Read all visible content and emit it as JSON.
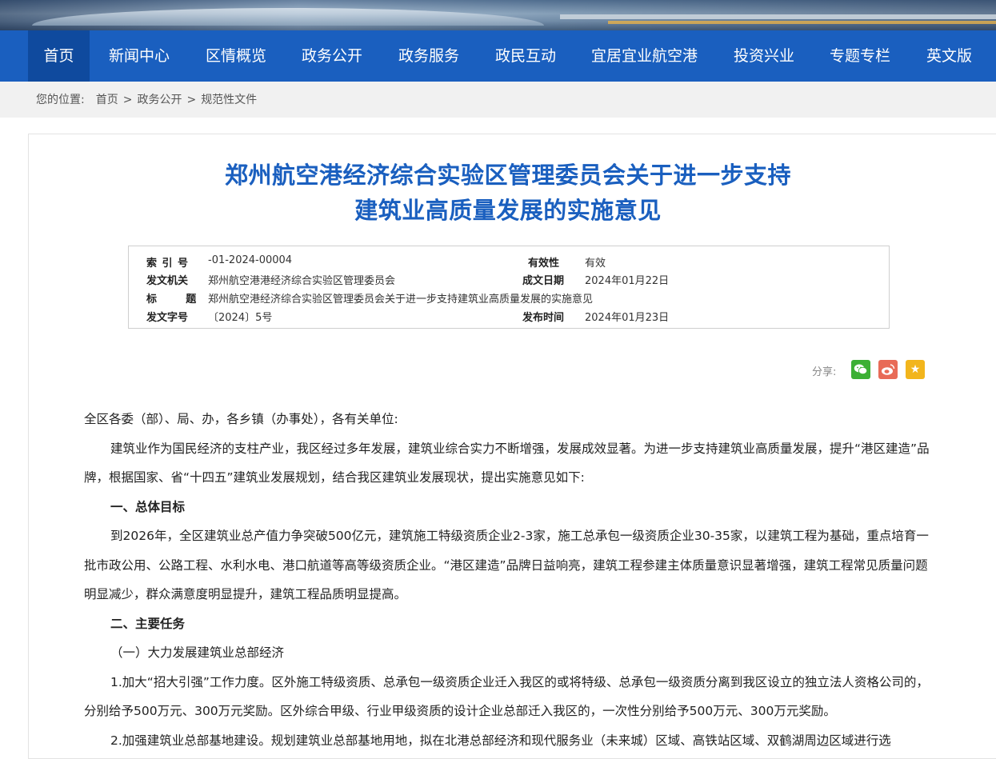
{
  "nav": {
    "items": [
      "首页",
      "新闻中心",
      "区情概览",
      "政务公开",
      "政务服务",
      "政民互动",
      "宜居宜业航空港",
      "投资兴业",
      "专题专栏",
      "英文版"
    ],
    "active_index": 0
  },
  "breadcrumb": {
    "lead": "您的位置:",
    "items": [
      "首页",
      "政务公开",
      "规范性文件"
    ],
    "sep": ">"
  },
  "article": {
    "title_line1": "郑州航空港经济综合实验区管理委员会关于进一步支持",
    "title_line2": "建筑业高质量发展的实施意见",
    "meta": {
      "index_label": "索  引  号",
      "index_value": "-01-2024-00004",
      "validity_label": "有效性",
      "validity_value": "有效",
      "issuer_label": "发文机关",
      "issuer_value": "郑州航空港港经济综合实验区管理委员会",
      "date_label": "成文日期",
      "date_value": "2024年01月22日",
      "subject_label": "标        题",
      "subject_value": "郑州航空港经济综合实验区管理委员会关于进一步支持建筑业高质量发展的实施意见",
      "docno_label": "发文字号",
      "docno_value": "〔2024〕5号",
      "publish_label": "发布时间",
      "publish_value": "2024年01月23日"
    },
    "share_label": "分享:",
    "paragraphs": {
      "salutation": "全区各委（部）、局、办，各乡镇（办事处），各有关单位:",
      "intro": "建筑业作为国民经济的支柱产业，我区经过多年发展，建筑业综合实力不断增强，发展成效显著。为进一步支持建筑业高质量发展，提升“港区建造”品牌，根据国家、省“十四五”建筑业发展规划，结合我区建筑业发展现状，提出实施意见如下:",
      "h1": "一、总体目标",
      "goal": "到2026年，全区建筑业总产值力争突破500亿元，建筑施工特级资质企业2-3家，施工总承包一级资质企业30-35家，以建筑工程为基础，重点培育一批市政公用、公路工程、水利水电、港口航道等高等级资质企业。“港区建造”品牌日益响亮，建筑工程参建主体质量意识显著增强，建筑工程常见质量问题明显减少，群众满意度明显提升，建筑工程品质明显提高。",
      "h2": "二、主要任务",
      "sub1": "（一）大力发展建筑业总部经济",
      "item1": "1.加大“招大引强”工作力度。区外施工特级资质、总承包一级资质企业迁入我区的或将特级、总承包一级资质分离到我区设立的独立法人资格公司的，分别给予500万元、300万元奖励。区外综合甲级、行业甲级资质的设计企业总部迁入我区的，一次性分别给予500万元、300万元奖励。",
      "item2": "2.加强建筑业总部基地建设。规划建筑业总部基地用地，拟在北港总部经济和现代服务业（未来城）区域、高铁站区域、双鹤湖周边区域进行选"
    }
  }
}
